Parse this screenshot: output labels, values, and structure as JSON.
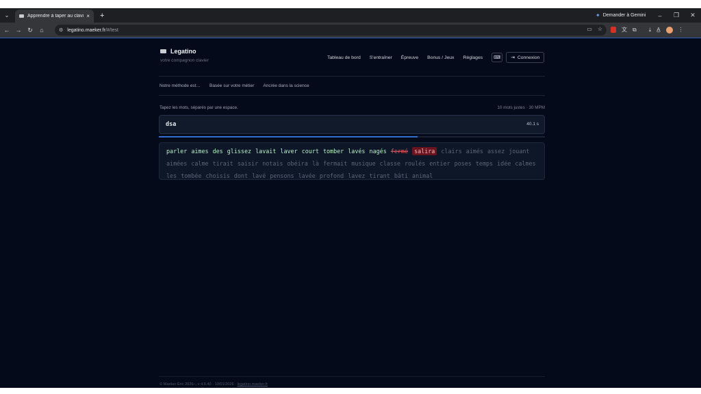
{
  "browser": {
    "tab_title": "Apprendre à taper au clavier sa",
    "tab_close": "×",
    "new_tab": "+",
    "gemini_label": "Demander à Gemini",
    "url_host": "legatino.maeker.fr",
    "url_path": "/#/test"
  },
  "site": {
    "name": "Legatino",
    "tagline": "votre compagnon clavier",
    "nav": [
      "Tableau de bord",
      "S'entraîner",
      "Épreuve",
      "Bonus / Jeux",
      "Réglages"
    ],
    "login_label": "Connexion",
    "subnav": [
      "Notre méthode est…",
      "Basée sur votre métier",
      "Ancrée dans la science"
    ]
  },
  "test": {
    "instruction": "Tapez les mots, séparés par une espace.",
    "stats": "10 mots justes · 30 MPM",
    "input_value": "dsa",
    "timer": "40.1 s",
    "progress": 0.67,
    "words_correct": [
      "parler",
      "aimes",
      "des",
      "glissez",
      "lavait",
      "laver",
      "court",
      "tomber",
      "lavés",
      "nagés"
    ],
    "word_error": "fermé",
    "word_current": "salira",
    "words_pending": [
      "clairs",
      "aimés",
      "assez",
      "jouant",
      "aimées",
      "calme",
      "tirait",
      "saisir",
      "notais",
      "obéira",
      "là",
      "fermait",
      "musique",
      "classe",
      "roulés",
      "entier",
      "poses",
      "temps",
      "idée",
      "calmes",
      "les",
      "tombée",
      "choisis",
      "dont",
      "lavé",
      "pensons",
      "lavée",
      "profond",
      "lavez",
      "tirant",
      "bâti",
      "animal"
    ]
  },
  "footer": {
    "text": "© Maeker Éric 2026–, v 4.5.40 · 19/01/2026 ·",
    "link": "legatino.maeker.fr"
  }
}
